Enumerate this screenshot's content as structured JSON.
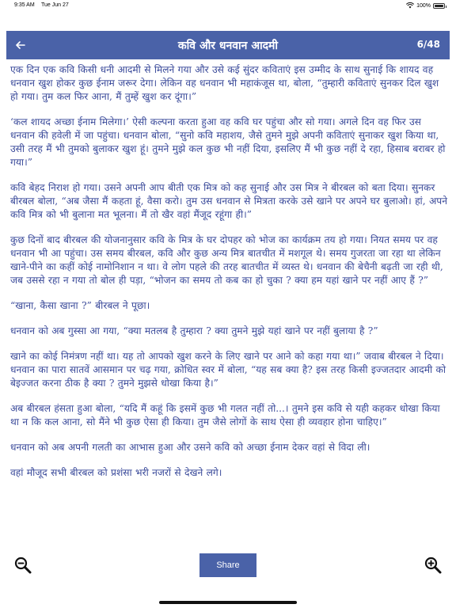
{
  "status_bar": {
    "time": "9:35 AM",
    "date": "Tue Jun 27",
    "battery": "100%",
    "icons": [
      "wifi-icon",
      "battery-icon"
    ]
  },
  "nav": {
    "back_icon": "back-arrow-icon",
    "title": "कवि और धनवान आदमी",
    "page_indicator": "6/48"
  },
  "story": {
    "paragraphs": [
      "एक दिन एक कवि किसी धनी आदमी से मिलने गया और उसे कई सुंदर कविताएं इस उम्मीद के साथ सुनाई कि शायद वह धनवान खुश होकर कुछ ईनाम जरूर देगा। लेकिन वह धनवान भी महाकंजूस था, बोला, “तुम्हारी कविताएं सुनकर दिल खुश हो गया। तुम कल फिर आना, मैं तुम्हें खुश कर दूंगा।”",
      "‘कल शायद अच्छा ईनाम मिलेगा।’ ऐसी कल्पना करता हुआ वह कवि घर पहुंचा और सो गया। अगले दिन वह फिर उस धनवान की हवेली में जा पहुंचा। धनवान बोला, “सुनो कवि महाशय, जैसे तुमने मुझे अपनी कविताएं सुनाकर खुश किया था, उसी तरह मैं भी तुमको बुलाकर खुश हूं। तुमने मुझे कल कुछ भी नहीं दिया, इसलिए मैं भी कुछ नहीं दे रहा, हिसाब बराबर हो गया।”",
      "कवि बेहद निराश हो गया। उसने अपनी आप बीती एक मित्र को कह सुनाई और उस मित्र ने बीरबल को बता दिया। सुनकर बीरबल बोला, “अब जैसा मैं कहता हूं, वैसा करो। तुम उस धनवान से मित्रता करके उसे खाने पर अपने घर बुलाओ। हां, अपने कवि मित्र को भी बुलाना मत भूलना। मैं तो खैर वहां मैंजूद रहूंगा ही।”",
      "कुछ दिनों बाद बीरबल की योजनानुसार कवि के मित्र के घर दोपहर को भोज का कार्यक्रम तय हो गया। नियत समय पर वह धनवान भी आ पहुंचा। उस समय बीरबल, कवि और कुछ अन्य मित्र बातचीत में मशगूल थे। समय गुजरता जा रहा था लेकिन खाने-पीने का कहीं कोई नामोनिशान न था। वे लोग पहले की तरह बातचीत में व्यस्त थे। धनवान की बेचैनी बढ़ती जा रही थी, जब उससे रहा न गया तो बोल ही पड़ा, “भोजन का समय तो कब का हो चुका ? क्या हम यहां खाने पर नहीं आए हैं ?”",
      "“खाना, कैसा खाना ?” बीरबल ने पूछा।",
      "धनवान को अब गुस्सा आ गया, “क्या मतलब है तुम्हारा ? क्या तुमने मुझे यहां खाने पर नहीं बुलाया है ?”",
      "खाने का कोई निमंत्रण नहीं था। यह तो आपको खुश करने के लिए खाने पर आने को कहा गया था।” जवाब बीरबल ने दिया। धनवान का पारा सातवें आसमान पर चढ़ गया, क्रोधित स्वर में बोला, “यह सब क्या है? इस तरह किसी इज्जतदार आदमी को बेइज्जत करना ठीक है क्या ? तुमने मुझसे धोखा किया है।”",
      "अब बीरबल हंसता हुआ बोला, “यदि मैं कहूं कि इसमें कुछ भी गलत नहीं तो...। तुमने इस कवि से यही कहकर धोखा किया था न कि कल आना, सो मैंने भी कुछ ऐसा ही किया। तुम जैसे लोगों के साथ ऐसा ही व्यवहार होना चाहिए।”",
      "धनवान को अब अपनी गलती का आभास हुआ और उसने कवि को अच्छा ईनाम देकर वहां से विदा ली।",
      "वहां मौजूद सभी बीरबल को प्रशंसा भरी नजरों से देखने लगे।"
    ]
  },
  "toolbar": {
    "zoom_out_icon": "zoom-out-icon",
    "zoom_in_icon": "zoom-in-icon",
    "share_label": "Share"
  },
  "colors": {
    "accent": "#4a62a8",
    "text": "#3a4a9a"
  }
}
